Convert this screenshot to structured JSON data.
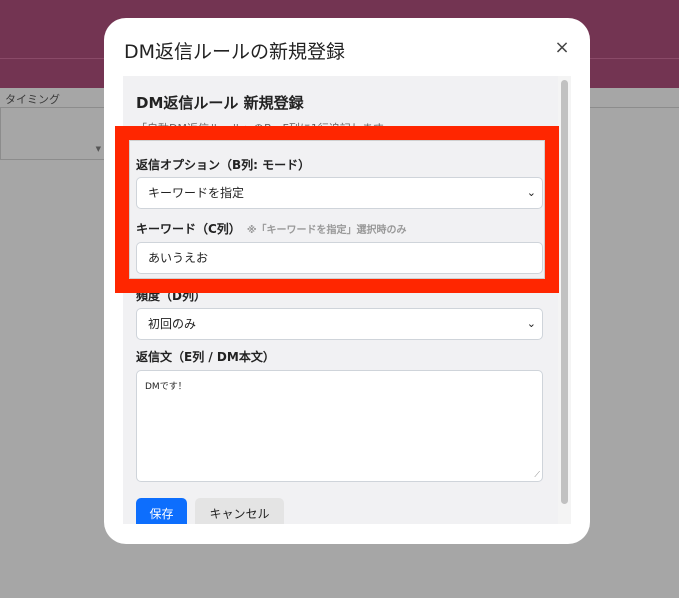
{
  "background": {
    "column_header": "タイミング"
  },
  "modal": {
    "title": "DM返信ルールの新規登録",
    "close_label": "×",
    "panel_title": "DM返信ルール 新規登録",
    "panel_description": "「自動DM返信ルール」のB〜F列に1行追記します。",
    "fields": {
      "reply_option": {
        "label": "返信オプション（B列: モード）",
        "value": "キーワードを指定"
      },
      "keyword": {
        "label": "キーワード（C列）",
        "note": "※「キーワードを指定」選択時のみ",
        "value": "あいうえお"
      },
      "frequency": {
        "label": "頻度（D列）",
        "value": "初回のみ"
      },
      "reply_text": {
        "label": "返信文（E列 / DM本文）",
        "value": "DMです！"
      }
    },
    "buttons": {
      "save": "保存",
      "cancel": "キャンセル"
    }
  },
  "colors": {
    "header_bg": "#733452",
    "highlight": "#ff2600",
    "primary_button": "#0d6efd"
  }
}
